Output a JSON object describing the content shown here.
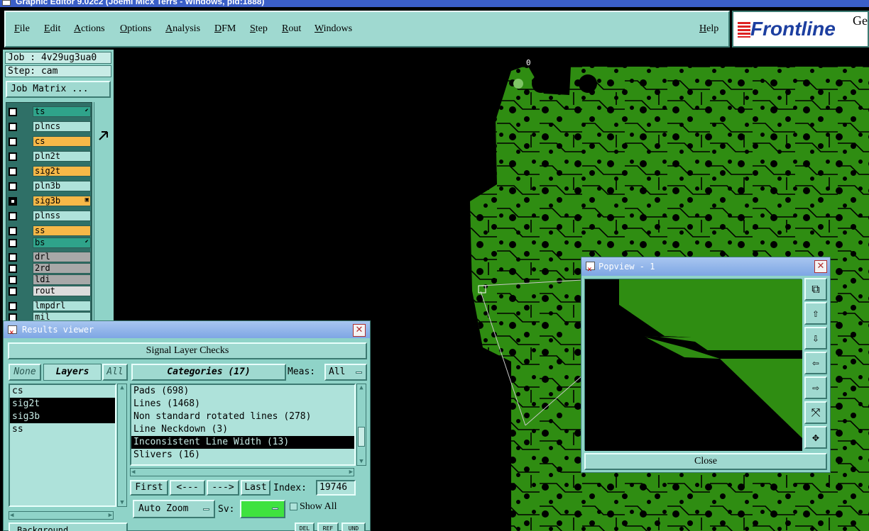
{
  "window": {
    "title": "Graphic Editor 9.02c2 (Joemi Micx Terrs - Windows, pid:1888)"
  },
  "menu": {
    "items": [
      "File",
      "Edit",
      "Actions",
      "Options",
      "Analysis",
      "DFM",
      "Step",
      "Rout",
      "Windows"
    ],
    "help": "Help"
  },
  "logo": {
    "text": "Frontline",
    "suffix": "Ge"
  },
  "job": {
    "job_label": "Job : 4v29ug3ua0",
    "step_label": "Step: cam",
    "matrix_button": "Job Matrix ..."
  },
  "layers": [
    {
      "name": "ts",
      "color": "#2fa38a",
      "marker": "⬋"
    },
    {
      "name": "plncs",
      "color": "#aee2da",
      "marker": ""
    },
    {
      "name": "cs",
      "color": "#f7b848",
      "marker": ""
    },
    {
      "name": "pln2t",
      "color": "#aee2da",
      "marker": ""
    },
    {
      "name": "sig2t",
      "color": "#f7b848",
      "marker": ""
    },
    {
      "name": "pln3b",
      "color": "#aee2da",
      "marker": ""
    },
    {
      "name": "sig3b",
      "color": "#f7b848",
      "marker": "▣",
      "selected": true
    },
    {
      "name": "plnss",
      "color": "#aee2da",
      "marker": ""
    },
    {
      "name": "ss",
      "color": "#f7b848",
      "marker": ""
    },
    {
      "name": "bs",
      "color": "#2fa38a",
      "marker": "⬋"
    },
    {
      "name": "drl",
      "color": "#a8a8a8",
      "marker": ""
    },
    {
      "name": "2rd",
      "color": "#a8a8a8",
      "marker": ""
    },
    {
      "name": "ldi",
      "color": "#a8a8a8",
      "marker": ""
    },
    {
      "name": "rout",
      "color": "#dcdcdc",
      "marker": ""
    },
    {
      "name": "lmpdrl",
      "color": "#aee2da",
      "marker": ""
    },
    {
      "name": "mil",
      "color": "#aee2da",
      "marker": ""
    }
  ],
  "canvas": {
    "origin_label": "0"
  },
  "results": {
    "title": "Results viewer",
    "header": "Signal Layer Checks",
    "none_button": "None",
    "layers_label": "Layers",
    "all_button": "All",
    "categories_label": "Categories (17)",
    "meas_label": "Meas:",
    "meas_value": "All",
    "layer_items": [
      {
        "text": "cs"
      },
      {
        "text": "sig2t",
        "sel": true
      },
      {
        "text": "sig3b",
        "sel": true
      },
      {
        "text": "ss"
      }
    ],
    "category_items": [
      {
        "text": "Pads (698)"
      },
      {
        "text": "Lines (1468)"
      },
      {
        "text": "Non standard rotated lines (278)"
      },
      {
        "text": "Line Neckdown (3)"
      },
      {
        "text": "Inconsistent Line Width (13)",
        "sel": true
      },
      {
        "text": "Slivers (16)"
      }
    ],
    "first": "First",
    "prev": "<---",
    "next": "--->",
    "last": "Last",
    "index_label": "Index:",
    "index_value": "19746",
    "auto_zoom": "Auto Zoom",
    "sv_label": "Sv:",
    "show_all": "Show All",
    "bottom_dropdown": "Background",
    "mini": [
      "DEL",
      "REF",
      "UND"
    ]
  },
  "popview": {
    "title": "Popview - 1",
    "close_button": "Close"
  }
}
